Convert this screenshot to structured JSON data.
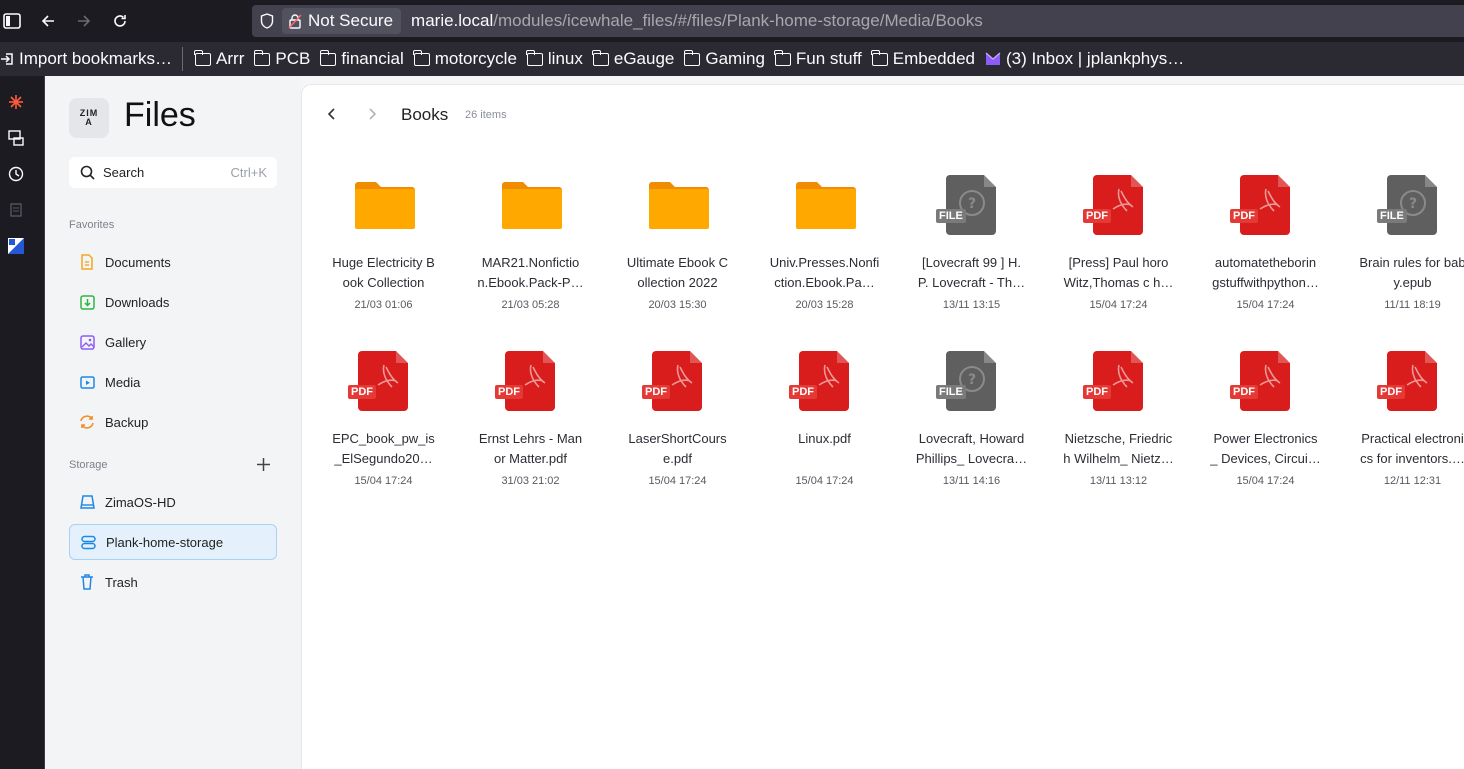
{
  "browser": {
    "security_label": "Not Secure",
    "url_host": "marie.local",
    "url_path": "/modules/icewhale_files/#/files/Plank-home-storage/Media/Books"
  },
  "bookmarks": {
    "import": "Import bookmarks…",
    "folders": [
      "Arrr",
      "PCB",
      "financial",
      "motorcycle",
      "linux",
      "eGauge",
      "Gaming",
      "Fun stuff",
      "Embedded"
    ],
    "inbox": "(3) Inbox | jplankphys…"
  },
  "sidebar": {
    "logo_text": "ZIMA",
    "title": "Files",
    "search_label": "Search",
    "search_shortcut": "Ctrl+K",
    "favorites_label": "Favorites",
    "favorites": [
      {
        "label": "Documents",
        "icon": "document-icon",
        "color": "#f5a623"
      },
      {
        "label": "Downloads",
        "icon": "download-icon",
        "color": "#2fb344"
      },
      {
        "label": "Gallery",
        "icon": "gallery-icon",
        "color": "#8b5cf6"
      },
      {
        "label": "Media",
        "icon": "media-icon",
        "color": "#1e88e5"
      },
      {
        "label": "Backup",
        "icon": "backup-icon",
        "color": "#f28c28"
      }
    ],
    "storage_label": "Storage",
    "storage": [
      {
        "label": "ZimaOS-HD",
        "icon": "disk-icon"
      },
      {
        "label": "Plank-home-storage",
        "icon": "storage-icon"
      },
      {
        "label": "Trash",
        "icon": "trash-icon"
      }
    ]
  },
  "main": {
    "folder_name": "Books",
    "item_count": "26 items",
    "files": [
      {
        "name": "Huge Electricity Book Collection",
        "display": "Huge Electricity B\nook Collection",
        "date": "21/03 01:06",
        "type": "folder"
      },
      {
        "name": "MAR21.Nonfiction.Ebook.Pack-P…",
        "display": "MAR21.Nonfictio\nn.Ebook.Pack-P…",
        "date": "21/03 05:28",
        "type": "folder"
      },
      {
        "name": "Ultimate Ebook Collection 2022",
        "display": "Ultimate Ebook C\nollection 2022",
        "date": "20/03 15:30",
        "type": "folder"
      },
      {
        "name": "Univ.Presses.Nonfiction.Ebook.Pa…",
        "display": "Univ.Presses.Nonfi\nction.Ebook.Pa…",
        "date": "20/03 15:28",
        "type": "folder"
      },
      {
        "name": "[Lovecraft 99 ] H. P. Lovecraft - Th…",
        "display": "[Lovecraft 99 ] H.\nP. Lovecraft - Th…",
        "date": "13/11 13:15",
        "type": "file"
      },
      {
        "name": "[Press] Paul horo Witz,Thomas c h…",
        "display": "[Press] Paul horo\nWitz,Thomas c h…",
        "date": "15/04 17:24",
        "type": "pdf"
      },
      {
        "name": "automatetheboringstuffwithpython…",
        "display": "automatetheborin\ngstuffwithpython…",
        "date": "15/04 17:24",
        "type": "pdf"
      },
      {
        "name": "Brain rules for baby.epub",
        "display": "Brain rules for bab\ny.epub",
        "date": "11/11 18:19",
        "type": "file"
      },
      {
        "name": "EPC_book_pw_is_ElSegundo20…",
        "display": "EPC_book_pw_is\n_ElSegundo20…",
        "date": "15/04 17:24",
        "type": "pdf"
      },
      {
        "name": "Ernst Lehrs - Man or Matter.pdf",
        "display": "Ernst Lehrs - Man\nor Matter.pdf",
        "date": "31/03 21:02",
        "type": "pdf"
      },
      {
        "name": "LaserShortCourse.pdf",
        "display": "LaserShortCours\ne.pdf",
        "date": "15/04 17:24",
        "type": "pdf"
      },
      {
        "name": "Linux.pdf",
        "display": "Linux.pdf",
        "date": "15/04 17:24",
        "type": "pdf"
      },
      {
        "name": "Lovecraft, Howard Phillips_ Lovecra…",
        "display": "Lovecraft, Howard\nPhillips_ Lovecra…",
        "date": "13/11 14:16",
        "type": "file"
      },
      {
        "name": "Nietzsche, Friedrich Wilhelm_ Nietz…",
        "display": "Nietzsche, Friedric\nh Wilhelm_ Nietz…",
        "date": "13/11 13:12",
        "type": "pdf"
      },
      {
        "name": "Power Electronics _ Devices, Circui…",
        "display": "Power Electronics\n_ Devices, Circui…",
        "date": "15/04 17:24",
        "type": "pdf"
      },
      {
        "name": "Practical electronics for inventors.…",
        "display": "Practical electroni\ncs for inventors.…",
        "date": "12/11 12:31",
        "type": "pdf"
      }
    ],
    "badges": {
      "pdf": "PDF",
      "file": "FILE"
    },
    "colors": {
      "folder": "#ffa800",
      "folder_tab": "#f08c00",
      "pdf": "#d91c1c",
      "file": "#5f5f5f"
    }
  }
}
